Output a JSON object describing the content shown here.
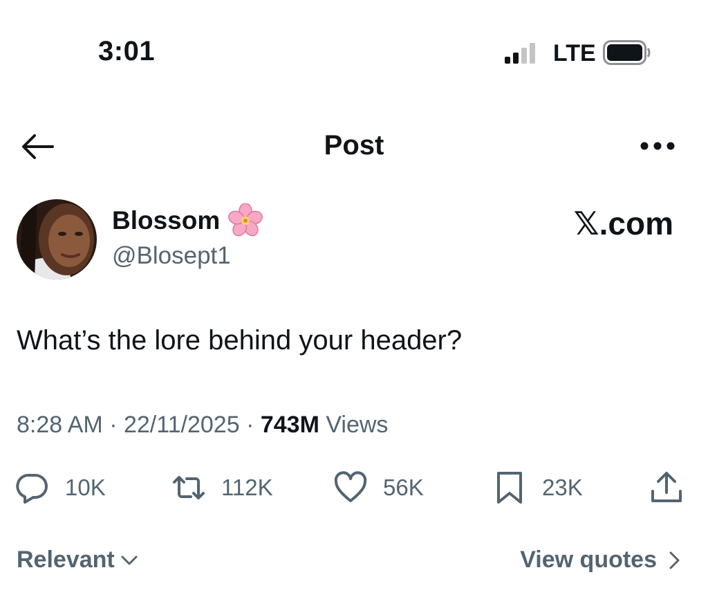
{
  "status_bar": {
    "time": "3:01",
    "network": "LTE",
    "icons": [
      "signal-icon",
      "battery-icon"
    ]
  },
  "nav": {
    "title": "Post",
    "icons": [
      "back-arrow-icon",
      "more-icon"
    ]
  },
  "author": {
    "display_name": "Blossom",
    "handle": "@Blosept1",
    "badge_icon": "cherry-blossom-icon"
  },
  "brand": {
    "x_glyph": "𝕏",
    "text": ".com"
  },
  "post": {
    "text": "What’s the lore behind your header?",
    "time": "8:28 AM",
    "sep1": " · ",
    "date": "22/11/2025",
    "sep2": " · ",
    "views_count": "743M",
    "views_label": " Views"
  },
  "actions": {
    "replies": "10K",
    "reposts": "112K",
    "likes": "56K",
    "bookmarks": "23K",
    "icons": [
      "reply-icon",
      "repost-icon",
      "like-icon",
      "bookmark-icon",
      "share-icon"
    ]
  },
  "footer": {
    "sort_label": "Relevant",
    "quotes_label": "View quotes"
  },
  "colors": {
    "text": "#0f1419",
    "secondary": "#536471",
    "background": "#ffffff"
  }
}
